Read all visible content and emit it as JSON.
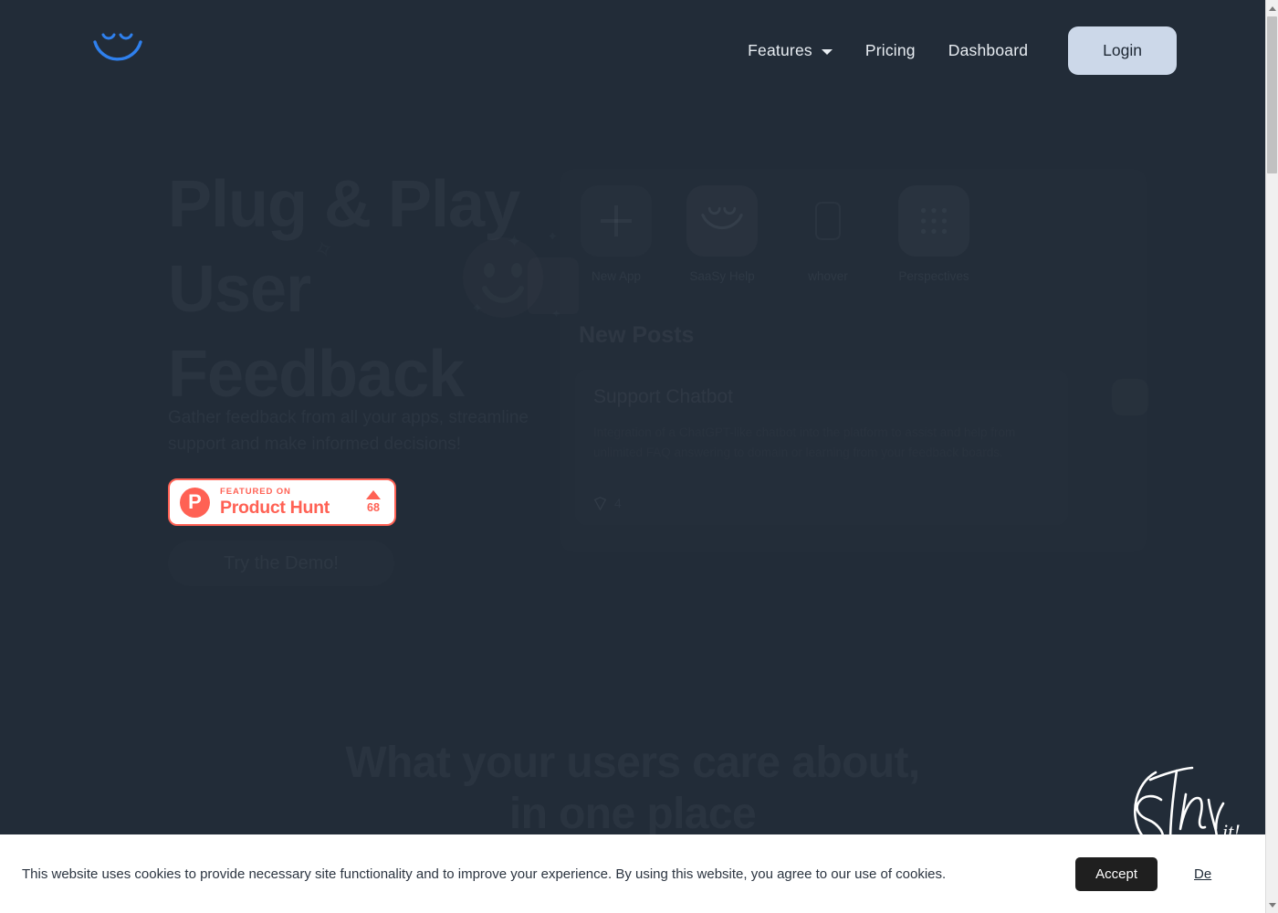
{
  "colors": {
    "background": "#222c38",
    "accent_blue": "#2f80ed",
    "login_bg": "#ccd8e9",
    "product_hunt": "#ff6154",
    "cookie_bg": "#ffffff",
    "cookie_accept_bg": "#1f1f1f"
  },
  "header": {
    "logo_name": "smiley-logo",
    "nav": [
      {
        "label": "Features",
        "has_caret": true
      },
      {
        "label": "Pricing",
        "has_caret": false
      },
      {
        "label": "Dashboard",
        "has_caret": false
      }
    ],
    "login_label": "Login"
  },
  "hero": {
    "title": "Plug & Play User Feedback",
    "subtitle": "Gather feedback from all your apps, streamline support and make informed decisions!",
    "demo_label": "Try the Demo!",
    "product_hunt": {
      "featured_label": "FEATURED ON",
      "name": "Product Hunt",
      "upvotes": "68",
      "logo_letter": "P"
    }
  },
  "preview": {
    "apps": [
      {
        "label": "New App",
        "icon": "plus-icon"
      },
      {
        "label": "SaaSy Help",
        "icon": "smiley-icon"
      },
      {
        "label": "whover",
        "icon": "whover-icon"
      },
      {
        "label": "Perspectives",
        "icon": "perspectives-icon"
      }
    ],
    "posts_heading": "New Posts",
    "post": {
      "title": "Support Chatbot",
      "body": "Integration of a ChatGPT-like chatbot into the platform to assist and help from unlimited FAQ answering to domain or learning from your feedback boards.",
      "comment_count": "4"
    }
  },
  "section": {
    "heading_line1": "What your users care about,",
    "heading_line2": "in one place"
  },
  "widget": {
    "script_text": "Try it!",
    "chat_name": "smiley-chat-button"
  },
  "cookie": {
    "message": "This website uses cookies to provide necessary site functionality and to improve your experience. By using this website, you agree to our use of cookies.",
    "accept_label": "Accept",
    "decline_label": "De"
  },
  "scrollbar": {
    "up_icon": "triangle-up-icon",
    "down_icon": "triangle-down-icon"
  }
}
